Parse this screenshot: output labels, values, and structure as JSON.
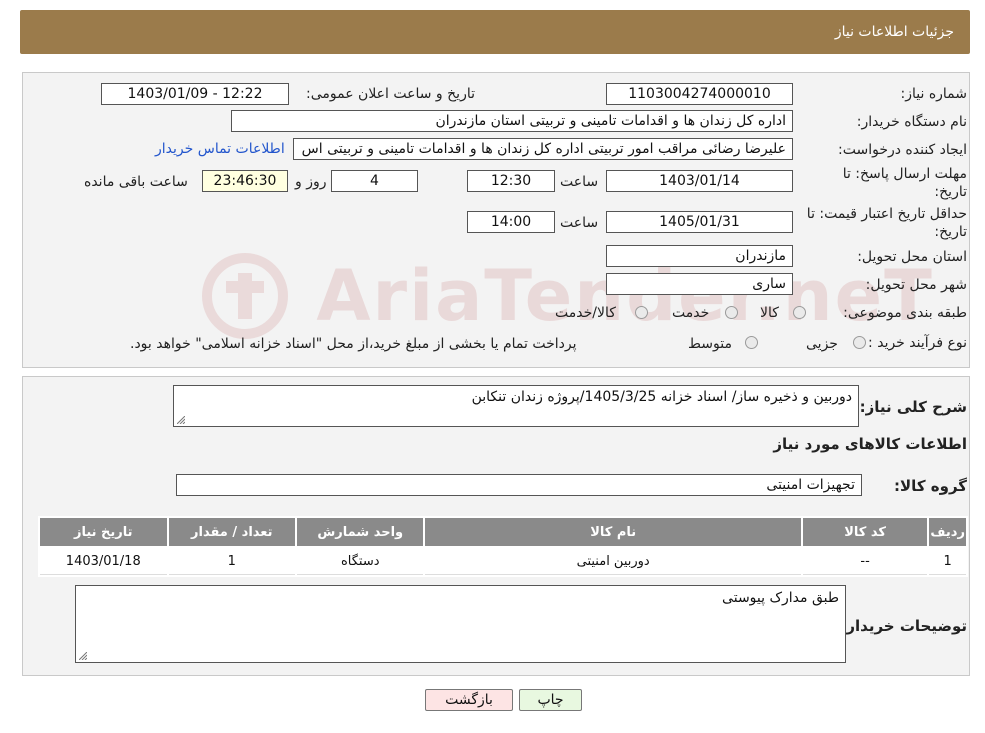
{
  "header": {
    "title": "جزئیات اطلاعات نیاز"
  },
  "form": {
    "need_number_label": "شماره نیاز:",
    "need_number": "1103004274000010",
    "announce_label": "تاریخ و ساعت اعلان عمومی:",
    "announce_value": "1403/01/09 - 12:22",
    "buyer_org_label": "نام دستگاه خریدار:",
    "buyer_org": "اداره کل زندان ها و اقدامات تامینی و تربیتی استان مازندران",
    "creator_label": "ایجاد کننده درخواست:",
    "creator": "علیرضا رضائی مراقب امور تربیتی اداره کل زندان ها و اقدامات تامینی و تربیتی اس",
    "contact_link": "اطلاعات تماس خریدار",
    "deadline_label_1": "مهلت ارسال پاسخ: تا",
    "deadline_label_2": "تاریخ:",
    "deadline_date": "1403/01/14",
    "time_label": "ساعت",
    "deadline_time": "12:30",
    "days_value": "4",
    "days_label": "روز و",
    "remaining_time": "23:46:30",
    "remaining_label": "ساعت باقی مانده",
    "validity_label_1": "حداقل تاریخ اعتبار قیمت: تا",
    "validity_label_2": "تاریخ:",
    "validity_date": "1405/01/31",
    "validity_time": "14:00",
    "province_label": "استان محل تحویل:",
    "province": "مازندران",
    "city_label": "شهر محل تحویل:",
    "city": "ساری",
    "category_label": "طبقه بندی موضوعی:",
    "category_options": [
      "کالا",
      "خدمت",
      "کالا/خدمت"
    ],
    "process_label": "نوع فرآیند خرید :",
    "process_options": [
      "جزیی",
      "متوسط"
    ],
    "process_note": "پرداخت تمام یا بخشی از مبلغ خرید،از محل \"اسناد خزانه اسلامی\" خواهد بود."
  },
  "watermark": "AriaTender.neT",
  "details": {
    "summary_label": "شرح کلی نیاز:",
    "summary": "دوربین و ذخیره ساز/ اسناد خزانه 1405/3/25/پروژه زندان تنکابن",
    "goods_info_title": "اطلاعات کالاهای مورد نیاز",
    "goods_group_label": "گروه کالا:",
    "goods_group": "تجهیزات امنیتی",
    "table": {
      "headers": [
        "ردیف",
        "کد کالا",
        "نام کالا",
        "واحد شمارش",
        "تعداد / مقدار",
        "تاریخ نیاز"
      ],
      "rows": [
        [
          "1",
          "--",
          "دوربین امنیتی",
          "دستگاه",
          "1",
          "1403/01/18"
        ]
      ]
    },
    "buyer_notes_label": "توضیحات خریدار:",
    "buyer_notes": "طبق مدارک پیوستی"
  },
  "buttons": {
    "print": "چاپ",
    "back": "بازگشت"
  }
}
